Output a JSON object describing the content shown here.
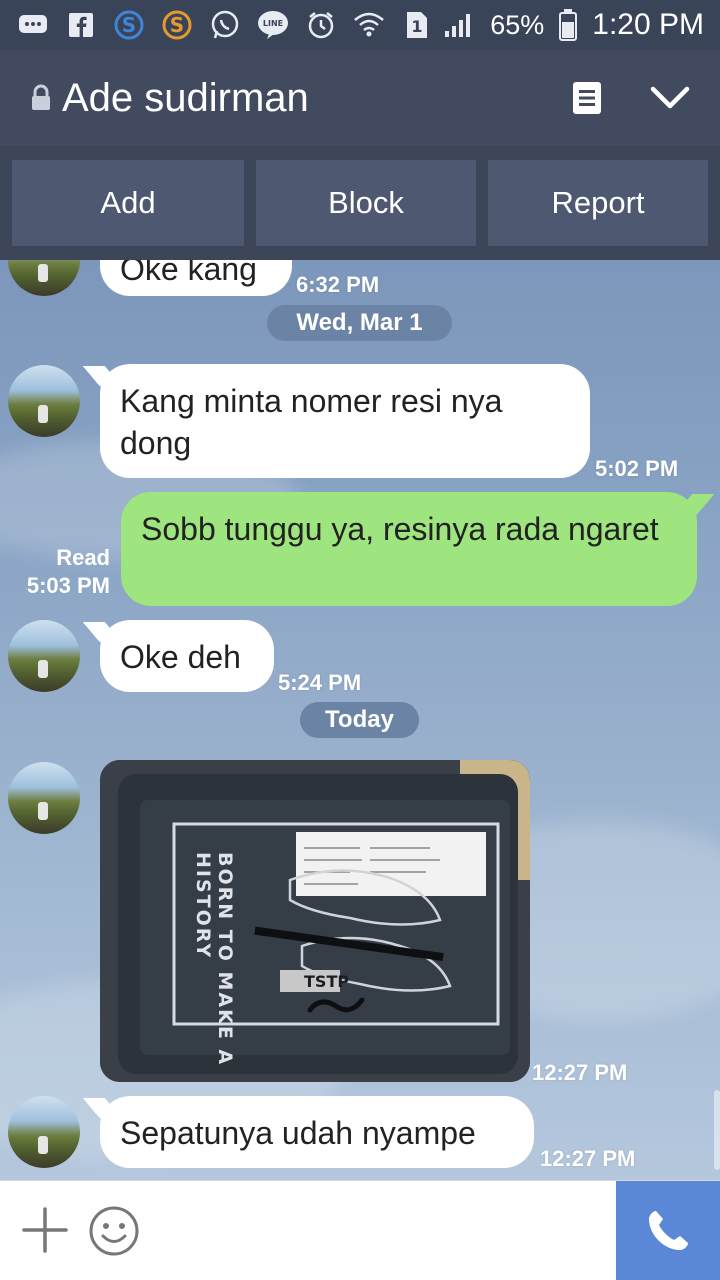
{
  "status_bar": {
    "icons": [
      "messages-icon",
      "facebook-icon",
      "s-app-icon-blue",
      "s-app-icon-orange",
      "whatsapp-icon",
      "line-icon",
      "alarm-icon",
      "wifi-icon",
      "sim-icon",
      "signal-icon",
      "battery-icon"
    ],
    "battery": "65%",
    "time": "1:20 PM"
  },
  "header": {
    "title": "Ade sudirman"
  },
  "actions": {
    "add": "Add",
    "block": "Block",
    "report": "Report"
  },
  "chat": {
    "partial_message": {
      "text": "Oke kang",
      "time": "6:32 PM"
    },
    "date_1": "Wed, Mar 1",
    "msg_1": {
      "text": "Kang minta nomer resi nya dong",
      "time": "5:02 PM"
    },
    "msg_2": {
      "text": "Sobb tunggu ya, resinya rada ngaret",
      "read": "Read",
      "time": "5:03 PM"
    },
    "msg_3": {
      "text": "Oke deh",
      "time": "5:24 PM"
    },
    "date_2": "Today",
    "photo_msg": {
      "time": "12:27 PM",
      "package_text": "BORN TO MAKE A HISTORY"
    },
    "msg_4": {
      "text": "Sepatunya udah nyampe",
      "time": "12:27 PM"
    }
  },
  "colors": {
    "header_bg": "#414a5f",
    "outgoing_bubble": "#9ee57f",
    "call_button": "#5b88d6"
  }
}
